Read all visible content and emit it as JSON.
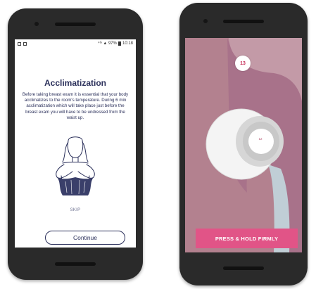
{
  "left_screen": {
    "status": {
      "right_text": "⁴ᴳ ▲ 97%",
      "time": "10:18"
    },
    "title": "Acclimatization",
    "description": "Before taking breast exam it is essential that your body acclimatizes to the room's temperature. During 6 min acclimatization which will take place just before the breast exam you will have to be undressed from the waist up.",
    "skip_label": "SKIP",
    "continue_label": "Continue",
    "illustration_icon": "undressing-woman-icon"
  },
  "right_screen": {
    "counter": "13",
    "device_label": "12",
    "press_label": "PRESS & HOLD FIRMLY",
    "device_icon": "breast-scanner-device-icon"
  },
  "colors": {
    "navy": "#2a2f5a",
    "pink_button": "#e15487",
    "skin": "#b88597",
    "phone": "#2a2a2a"
  }
}
